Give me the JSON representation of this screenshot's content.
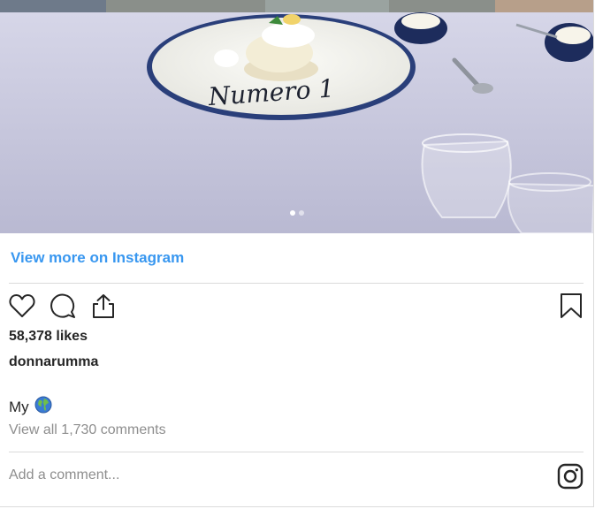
{
  "post": {
    "view_more_label": "View more on Instagram",
    "likes": "58,378 likes",
    "username": "donnarumma",
    "caption_text": "My",
    "caption_emoji": "globe-icon",
    "view_comments_label": "View all 1,730 comments",
    "comment_placeholder": "Add a comment...",
    "plate_text": "Numero 1"
  },
  "carousel": {
    "slide_count": 2,
    "active_slide": 1
  },
  "icons": {
    "like": "heart-icon",
    "comment": "comment-bubble-icon",
    "share": "share-icon",
    "save": "bookmark-icon",
    "brand": "instagram-icon"
  },
  "colors": {
    "link": "#3897f0",
    "text": "#262626",
    "muted": "#8e8e8e",
    "divider": "#dbdbdb"
  }
}
